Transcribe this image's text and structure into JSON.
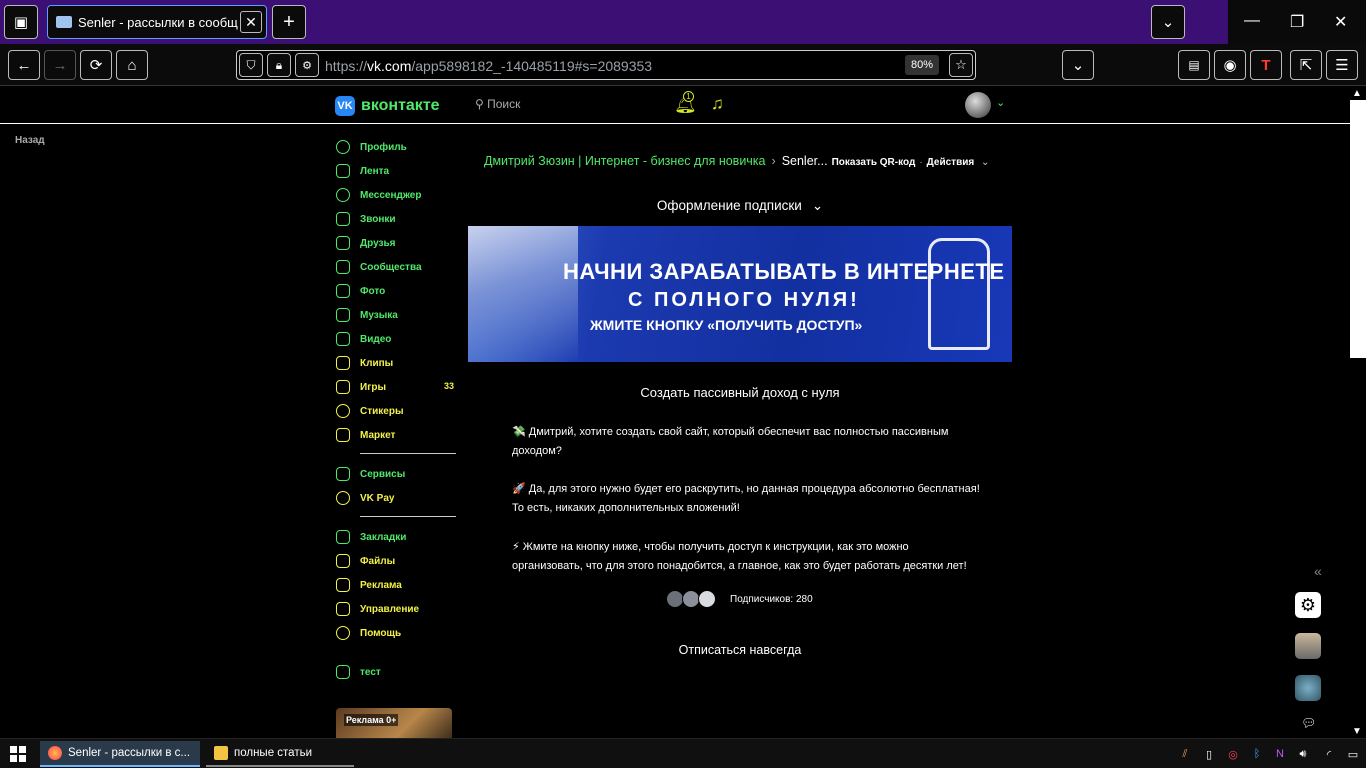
{
  "browser": {
    "tab_title": "Senler - рассылки в сообщест",
    "url_prefix": "https://",
    "url_domain": "vk.com",
    "url_path": "/app5898182_-140485119#s=2089353",
    "zoom": "80%"
  },
  "vk": {
    "logo_text": "вконтакте",
    "search_placeholder": "Поиск",
    "notifications_count": "1",
    "back_link": "Назад"
  },
  "menu": {
    "items": [
      {
        "label": "Профиль"
      },
      {
        "label": "Лента"
      },
      {
        "label": "Мессенджер"
      },
      {
        "label": "Звонки"
      },
      {
        "label": "Друзья"
      },
      {
        "label": "Сообщества"
      },
      {
        "label": "Фото"
      },
      {
        "label": "Музыка"
      },
      {
        "label": "Видео"
      },
      {
        "label": "Клипы"
      },
      {
        "label": "Игры",
        "count": "33"
      },
      {
        "label": "Стикеры"
      },
      {
        "label": "Маркет"
      },
      {
        "label": "Сервисы"
      },
      {
        "label": "VK Pay"
      },
      {
        "label": "Закладки"
      },
      {
        "label": "Файлы"
      },
      {
        "label": "Реклама"
      },
      {
        "label": "Управление"
      },
      {
        "label": "Помощь"
      },
      {
        "label": "тест"
      }
    ],
    "ad_label": "Реклама 0+"
  },
  "main": {
    "breadcrumb_group": "Дмитрий Зюзин | Интернет - бизнес для новичка",
    "breadcrumb_app": "Senler...",
    "qr_link": "Показать QR-код",
    "actions_link": "Действия",
    "subscription_title": "Оформление подписки",
    "banner": {
      "line1": "НАЧНИ ЗАРАБАТЫВАТЬ В ИНТЕРНЕТЕ",
      "line2": "С ПОЛНОГО НУЛЯ!",
      "line3": "ЖМИТЕ КНОПКУ «ПОЛУЧИТЬ ДОСТУП»"
    },
    "subscription_name": "Создать пассивный доход с нуля",
    "desc1": "💸 Дмитрий, хотите создать свой сайт, который обеспечит вас полностью пассивным доходом?",
    "desc2": "🚀 Да, для этого нужно будет его раскрутить, но данная процедура абсолютно бесплатная! То есть, никаких дополнительных вложений!",
    "desc3": "⚡ Жмите на кнопку ниже, чтобы получить доступ к инструкции, как это можно организовать, что для этого понадобится, а главное, как это будет работать десятки лет!",
    "subscribers": "Подписчиков: 280",
    "unsubscribe": "Отписаться навсегда"
  },
  "taskbar": {
    "task1": "Senler - рассылки в с...",
    "task2": "полные статьи"
  },
  "colors": {
    "accent_green": "#50e86a",
    "accent_yellow": "#f2f24a",
    "tabbar_purple": "#3b0f73"
  }
}
